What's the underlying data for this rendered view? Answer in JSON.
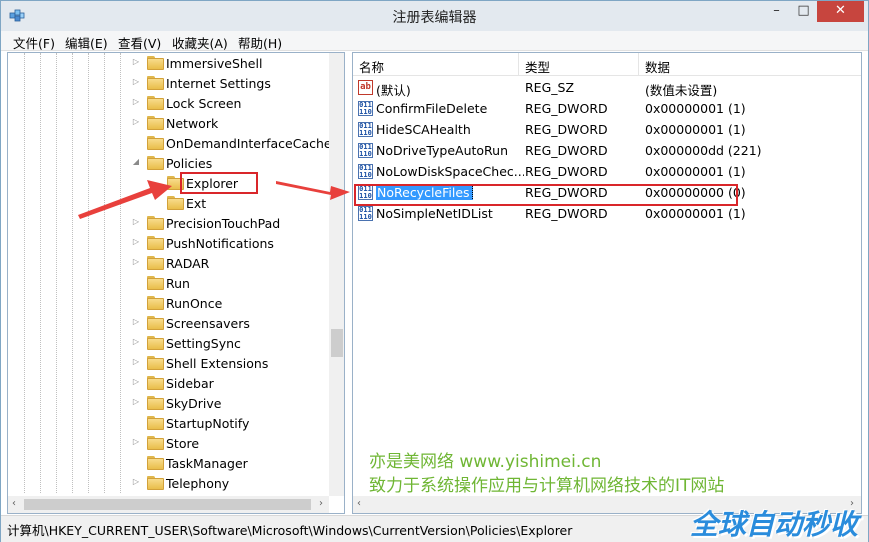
{
  "window": {
    "title": "注册表编辑器",
    "minimize_glyph": "–",
    "maximize_glyph": "□",
    "close_glyph": "✕"
  },
  "menu": [
    "文件(F)",
    "编辑(E)",
    "查看(V)",
    "收藏夹(A)",
    "帮助(H)"
  ],
  "tree": {
    "items": [
      {
        "label": "ImmersiveShell",
        "expander": "▷"
      },
      {
        "label": "Internet Settings",
        "expander": "▷"
      },
      {
        "label": "Lock Screen",
        "expander": "▷"
      },
      {
        "label": "Network",
        "expander": "▷"
      },
      {
        "label": "OnDemandInterfaceCache",
        "expander": ""
      },
      {
        "label": "Policies",
        "expander": "◢"
      },
      {
        "label": "Explorer",
        "expander": "",
        "selected": true
      },
      {
        "label": "Ext",
        "expander": ""
      },
      {
        "label": "PrecisionTouchPad",
        "expander": "▷"
      },
      {
        "label": "PushNotifications",
        "expander": "▷"
      },
      {
        "label": "RADAR",
        "expander": "▷"
      },
      {
        "label": "Run",
        "expander": ""
      },
      {
        "label": "RunOnce",
        "expander": ""
      },
      {
        "label": "Screensavers",
        "expander": "▷"
      },
      {
        "label": "SettingSync",
        "expander": "▷"
      },
      {
        "label": "Shell Extensions",
        "expander": "▷"
      },
      {
        "label": "Sidebar",
        "expander": "▷"
      },
      {
        "label": "SkyDrive",
        "expander": "▷"
      },
      {
        "label": "StartupNotify",
        "expander": ""
      },
      {
        "label": "Store",
        "expander": "▷"
      },
      {
        "label": "TaskManager",
        "expander": ""
      },
      {
        "label": "Telephony",
        "expander": "▷"
      }
    ],
    "scroll_left": "‹",
    "scroll_right": "›"
  },
  "values_table": {
    "headers": [
      "名称",
      "类型",
      "数据"
    ],
    "rows": [
      {
        "icon": "ab",
        "name": "(默认)",
        "type": "REG_SZ",
        "data": "(数值未设置)"
      },
      {
        "icon": "011 110",
        "name": "ConfirmFileDelete",
        "type": "REG_DWORD",
        "data": "0x00000001 (1)"
      },
      {
        "icon": "011 110",
        "name": "HideSCAHealth",
        "type": "REG_DWORD",
        "data": "0x00000001 (1)"
      },
      {
        "icon": "011 110",
        "name": "NoDriveTypeAutoRun",
        "type": "REG_DWORD",
        "data": "0x000000dd (221)"
      },
      {
        "icon": "011 110",
        "name": "NoLowDiskSpaceChec...",
        "type": "REG_DWORD",
        "data": "0x00000001 (1)"
      },
      {
        "icon": "011 110",
        "name": "NoRecycleFiles",
        "type": "REG_DWORD",
        "data": "0x00000000 (0)",
        "selected": true
      },
      {
        "icon": "011 110",
        "name": "NoSimpleNetIDList",
        "type": "REG_DWORD",
        "data": "0x00000001 (1)"
      }
    ],
    "scroll_left": "‹",
    "scroll_right": "›"
  },
  "watermark": {
    "line1": "亦是美网络 www.yishimei.cn",
    "line2": "致力于系统操作应用与计算机网络技术的IT网站"
  },
  "status_path": "计算机\\HKEY_CURRENT_USER\\Software\\Microsoft\\Windows\\CurrentVersion\\Policies\\Explorer",
  "logo_text": "全球自动秒收",
  "colors": {
    "highlight_red": "#d9262a",
    "selection_blue": "#3399ff",
    "watermark_green": "#6fb634",
    "close_button": "#c7453e"
  }
}
